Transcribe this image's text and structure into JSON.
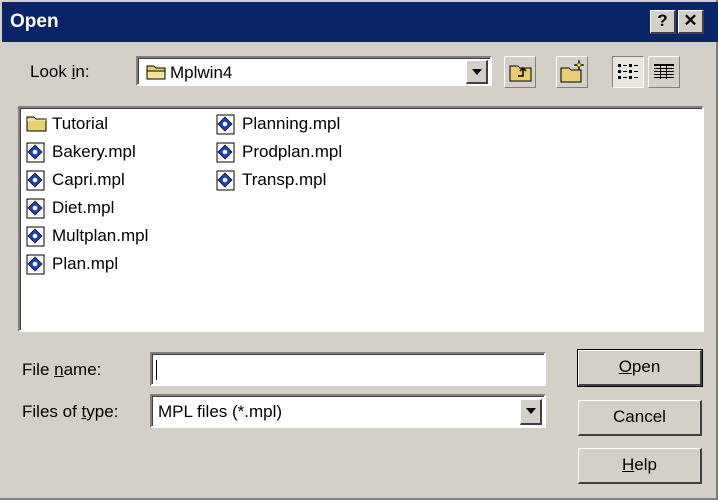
{
  "window": {
    "title": "Open",
    "help_button": "?",
    "close_button": "✕"
  },
  "look_in": {
    "label_prefix": "Look ",
    "label_accel": "i",
    "label_suffix": "n:",
    "value": "Mplwin4"
  },
  "toolbar": {
    "up_icon": "up-one-level-icon",
    "new_folder_icon": "new-folder-icon",
    "list_icon": "list-view-icon",
    "details_icon": "details-view-icon"
  },
  "files": [
    {
      "name": "Tutorial",
      "type": "folder"
    },
    {
      "name": "Bakery.mpl",
      "type": "mpl"
    },
    {
      "name": "Capri.mpl",
      "type": "mpl"
    },
    {
      "name": "Diet.mpl",
      "type": "mpl"
    },
    {
      "name": "Multplan.mpl",
      "type": "mpl"
    },
    {
      "name": "Plan.mpl",
      "type": "mpl"
    },
    {
      "name": "Planning.mpl",
      "type": "mpl"
    },
    {
      "name": "Prodplan.mpl",
      "type": "mpl"
    },
    {
      "name": "Transp.mpl",
      "type": "mpl"
    }
  ],
  "file_name": {
    "label_prefix": "File ",
    "label_accel": "n",
    "label_suffix": "ame:",
    "value": ""
  },
  "file_type": {
    "label_prefix": "Files of ",
    "label_accel": "t",
    "label_suffix": "ype:",
    "value": "MPL files (*.mpl)"
  },
  "buttons": {
    "open_accel": "O",
    "open_rest": "pen",
    "cancel": "Cancel",
    "help_accel": "H",
    "help_rest": "elp"
  },
  "colors": {
    "titlebar": "#0a246a",
    "face": "#d4d0c8"
  }
}
